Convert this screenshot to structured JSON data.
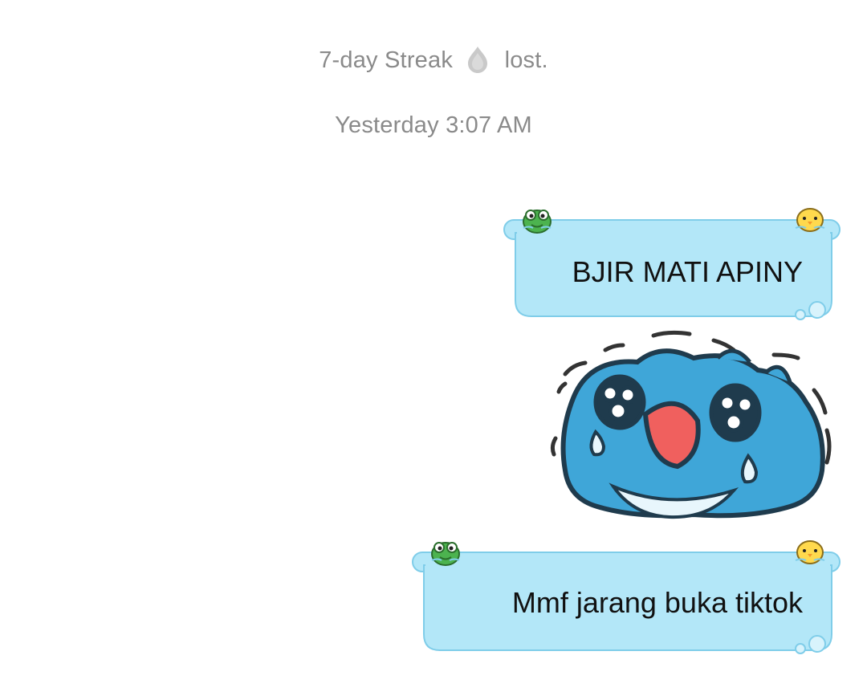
{
  "system": {
    "streak_before": "7-day Streak",
    "streak_after": "lost.",
    "timestamp": "Yesterday 3:07 AM"
  },
  "messages": [
    {
      "text": "BJIR MATI APINY",
      "sender": "me"
    },
    {
      "text": "Mmf jarang buka tiktok",
      "sender": "me"
    }
  ],
  "sticker": {
    "name": "crying-blue-blob-sticker"
  },
  "icons": {
    "streak": "flame-icon",
    "bubble_left": "green-frog-icon",
    "bubble_right": "yellow-chick-icon",
    "bubble_corner": "bubbles-icon"
  },
  "colors": {
    "bubble_fill": "#b3e7f8",
    "bubble_border": "#7fcde9",
    "system_text": "#8a8a8a",
    "sticker_body": "#3fa6d8",
    "sticker_mouth": "#f0605e"
  }
}
